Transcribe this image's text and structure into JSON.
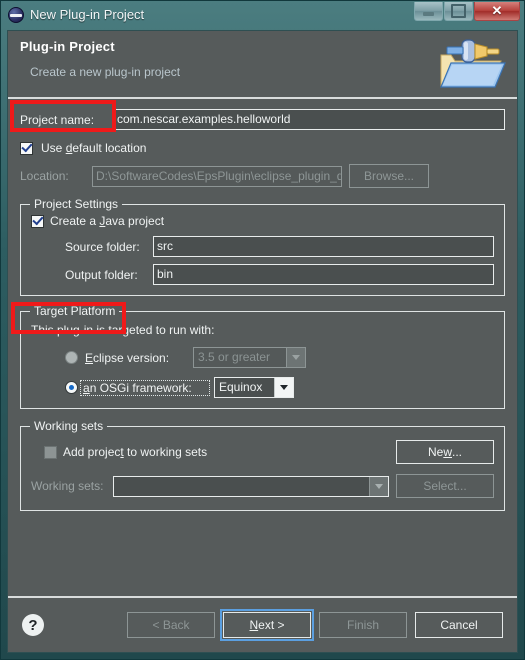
{
  "window": {
    "title": "New Plug-in Project",
    "icon": "eclipse-circle-icon",
    "buttons": {
      "minimize": "minimize-icon",
      "maximize": "maximize-icon",
      "close": "✕"
    }
  },
  "banner": {
    "title": "Plug-in Project",
    "subtitle": "Create a new plug-in project",
    "icon": "folder-plugin-icon"
  },
  "project": {
    "name_label": "Project name:",
    "name_value": "com.nescar.examples.helloworld",
    "use_default_location": {
      "label_pre": "Use ",
      "label_mnemonic": "d",
      "label_post": "efault location",
      "checked": true
    },
    "location_label": "Location:",
    "location_value": "D:\\SoftwareCodes\\EpsPlugin\\eclipse_plugin_dev_examp",
    "browse_label": "Browse...",
    "browse_enabled": false
  },
  "project_settings": {
    "group_title": "Project Settings",
    "create_java": {
      "label_pre": "Create a ",
      "label_mnemonic": "J",
      "label_post": "ava project",
      "checked": true
    },
    "source_folder_label": "Source folder:",
    "source_folder_value": "src",
    "output_folder_label": "Output folder:",
    "output_folder_value": "bin"
  },
  "target_platform": {
    "group_title": "Target Platform",
    "description": "This plug-in is targeted to run with:",
    "eclipse_version": {
      "label_pre": "",
      "label_mnemonic": "E",
      "label_post": "clipse version:",
      "selected": false,
      "combo_value": "3.5 or greater",
      "combo_enabled": false
    },
    "osgi_framework": {
      "label_pre": "",
      "label_mnemonic": "a",
      "label_post": "n OSGi framework:",
      "selected": true,
      "focused": true,
      "combo_value": "Equinox",
      "combo_enabled": true
    }
  },
  "working_sets": {
    "group_title": "Working sets",
    "add_to_working_sets": {
      "label_pre": "Add projec",
      "label_mnemonic": "t",
      "label_post": " to working sets",
      "checked": false
    },
    "new_label": "New...",
    "new_mnemonic": "w",
    "working_sets_label": "Working sets:",
    "working_sets_value": "",
    "select_label": "Select...",
    "select_enabled": false
  },
  "footer": {
    "help_icon": "?",
    "back_label": "< Back",
    "back_enabled": false,
    "next_label_pre": "",
    "next_mnemonic": "N",
    "next_label_post": "ext >",
    "next_focused": true,
    "finish_label": "Finish",
    "finish_enabled": false,
    "cancel_label": "Cancel"
  },
  "annotations": [
    {
      "name": "project-name-highlight"
    },
    {
      "name": "target-platform-highlight"
    }
  ],
  "colors": {
    "frame": "#2d5d61",
    "dialog_bg": "#565b5b",
    "text": "#f0f3f3",
    "disabled_text": "#8e9696",
    "accent_blue": "#1569c6",
    "annotation_red": "#ef1a1a",
    "close_red": "#b6413c"
  }
}
